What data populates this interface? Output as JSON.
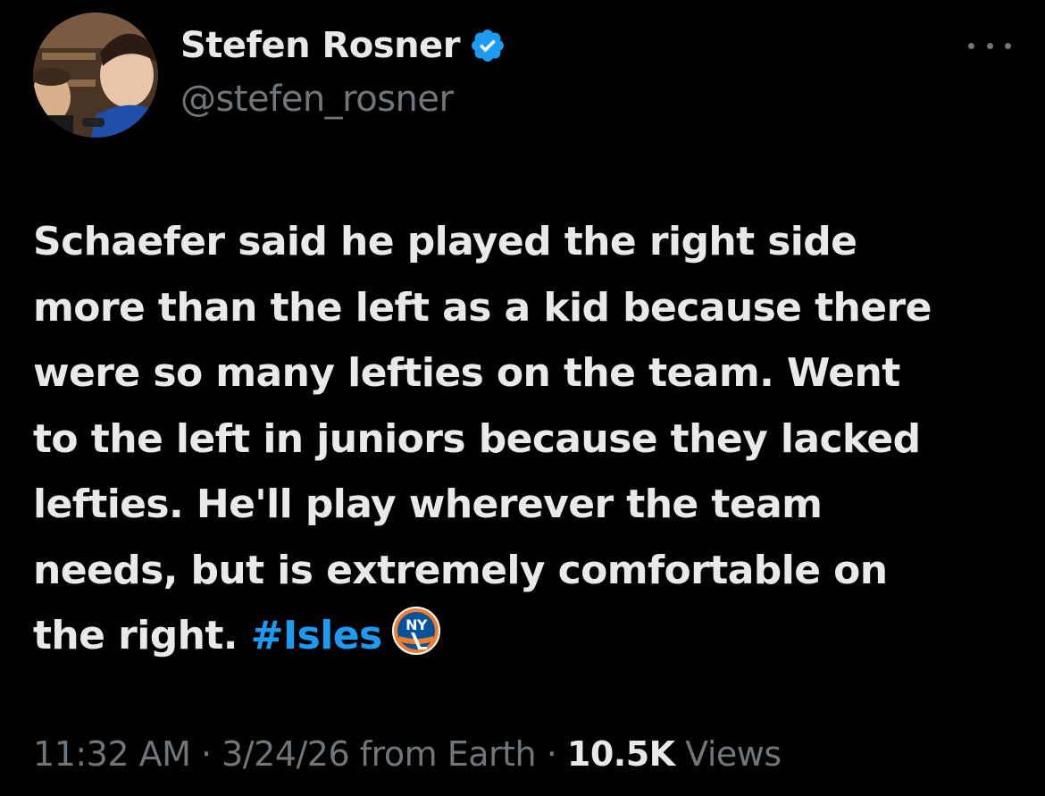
{
  "author": {
    "name": "Stefen Rosner",
    "handle": "@stefen_rosner",
    "avatar_icon": "profile-photo",
    "verified_icon": "verified-badge-icon",
    "verified_color": "#1d9bf0"
  },
  "tweet": {
    "lines": [
      "Schaefer said he played the right side",
      "more than the left as a kid because there",
      "were so many lefties on the team.  Went",
      "to the left in juniors because they lacked",
      "lefties. He'll play wherever the team",
      "needs, but is extremely comfortable on"
    ],
    "last_line_prefix": "the right. ",
    "hashtag": "#Isles",
    "hashtag_color": "#1d9bf0",
    "team_logo_icon": "ny-islanders-logo-icon"
  },
  "meta": {
    "time": "11:32 AM",
    "separator1": " · ",
    "date": "3/24/26",
    "source": " from Earth",
    "separator2": " · ",
    "views_count": "10.5K",
    "views_label": " Views"
  },
  "colors": {
    "background": "#000000",
    "text": "#e7e9ea",
    "muted": "#71767b",
    "accent": "#1d9bf0"
  }
}
